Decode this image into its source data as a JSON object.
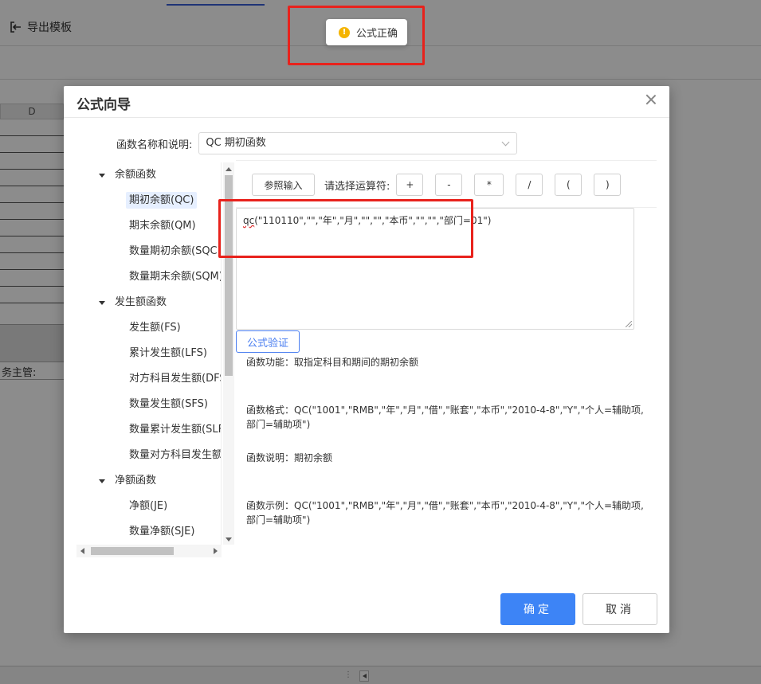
{
  "app": {
    "export_label": "导出模板",
    "column_header": "D",
    "sheet_label": "务主管:"
  },
  "toast": {
    "message": "公式正确",
    "icon": "warning-icon"
  },
  "dialog": {
    "title": "公式向导",
    "fn_label": "函数名称和说明:",
    "fn_value": "QC 期初函数",
    "ref_button": "参照输入",
    "op_label": "请选择运算符:",
    "operators": [
      "+",
      "-",
      "*",
      "/",
      "(",
      ")"
    ],
    "formula_prefix": "qc",
    "formula_rest": "(\"110110\",\"\",\"年\",\"月\",\"\",\"\",\"本币\",\"\",\"\",\"部门=01\")",
    "verify_button": "公式验证",
    "info_function": "函数功能：取指定科目和期间的期初余额",
    "info_format": "函数格式：QC(\"1001\",\"RMB\",\"年\",\"月\",\"借\",\"账套\",\"本币\",\"2010-4-8\",\"Y\",\"个人=辅助项,部门=辅助项\")",
    "info_desc": "函数说明：期初余额",
    "info_example": "函数示例：QC(\"1001\",\"RMB\",\"年\",\"月\",\"借\",\"账套\",\"本币\",\"2010-4-8\",\"Y\",\"个人=辅助项,部门=辅助项\")",
    "ok_button": "确定",
    "cancel_button": "取消"
  },
  "tree": {
    "groups": [
      {
        "label": "余额函数",
        "items": [
          "期初余额(QC)",
          "期末余额(QM)",
          "数量期初余额(SQC)",
          "数量期末余额(SQM)"
        ]
      },
      {
        "label": "发生额函数",
        "items": [
          "发生额(FS)",
          "累计发生额(LFS)",
          "对方科目发生额(DFS)",
          "数量发生额(SFS)",
          "数量累计发生额(SLFS",
          "数量对方科目发生额(S"
        ]
      },
      {
        "label": "净额函数",
        "items": [
          "净额(JE)",
          "数量净额(SJE)"
        ]
      }
    ],
    "selected": "期初余额(QC)"
  }
}
